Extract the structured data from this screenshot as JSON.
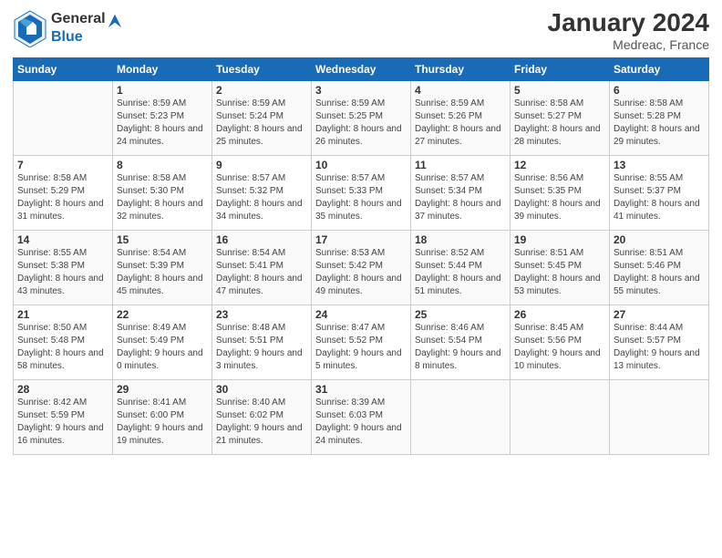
{
  "logo": {
    "text_general": "General",
    "text_blue": "Blue"
  },
  "title": "January 2024",
  "location": "Medreac, France",
  "days_of_week": [
    "Sunday",
    "Monday",
    "Tuesday",
    "Wednesday",
    "Thursday",
    "Friday",
    "Saturday"
  ],
  "weeks": [
    [
      {
        "day": "",
        "sunrise": "",
        "sunset": "",
        "daylight": ""
      },
      {
        "day": "1",
        "sunrise": "Sunrise: 8:59 AM",
        "sunset": "Sunset: 5:23 PM",
        "daylight": "Daylight: 8 hours and 24 minutes."
      },
      {
        "day": "2",
        "sunrise": "Sunrise: 8:59 AM",
        "sunset": "Sunset: 5:24 PM",
        "daylight": "Daylight: 8 hours and 25 minutes."
      },
      {
        "day": "3",
        "sunrise": "Sunrise: 8:59 AM",
        "sunset": "Sunset: 5:25 PM",
        "daylight": "Daylight: 8 hours and 26 minutes."
      },
      {
        "day": "4",
        "sunrise": "Sunrise: 8:59 AM",
        "sunset": "Sunset: 5:26 PM",
        "daylight": "Daylight: 8 hours and 27 minutes."
      },
      {
        "day": "5",
        "sunrise": "Sunrise: 8:58 AM",
        "sunset": "Sunset: 5:27 PM",
        "daylight": "Daylight: 8 hours and 28 minutes."
      },
      {
        "day": "6",
        "sunrise": "Sunrise: 8:58 AM",
        "sunset": "Sunset: 5:28 PM",
        "daylight": "Daylight: 8 hours and 29 minutes."
      }
    ],
    [
      {
        "day": "7",
        "sunrise": "Sunrise: 8:58 AM",
        "sunset": "Sunset: 5:29 PM",
        "daylight": "Daylight: 8 hours and 31 minutes."
      },
      {
        "day": "8",
        "sunrise": "Sunrise: 8:58 AM",
        "sunset": "Sunset: 5:30 PM",
        "daylight": "Daylight: 8 hours and 32 minutes."
      },
      {
        "day": "9",
        "sunrise": "Sunrise: 8:57 AM",
        "sunset": "Sunset: 5:32 PM",
        "daylight": "Daylight: 8 hours and 34 minutes."
      },
      {
        "day": "10",
        "sunrise": "Sunrise: 8:57 AM",
        "sunset": "Sunset: 5:33 PM",
        "daylight": "Daylight: 8 hours and 35 minutes."
      },
      {
        "day": "11",
        "sunrise": "Sunrise: 8:57 AM",
        "sunset": "Sunset: 5:34 PM",
        "daylight": "Daylight: 8 hours and 37 minutes."
      },
      {
        "day": "12",
        "sunrise": "Sunrise: 8:56 AM",
        "sunset": "Sunset: 5:35 PM",
        "daylight": "Daylight: 8 hours and 39 minutes."
      },
      {
        "day": "13",
        "sunrise": "Sunrise: 8:55 AM",
        "sunset": "Sunset: 5:37 PM",
        "daylight": "Daylight: 8 hours and 41 minutes."
      }
    ],
    [
      {
        "day": "14",
        "sunrise": "Sunrise: 8:55 AM",
        "sunset": "Sunset: 5:38 PM",
        "daylight": "Daylight: 8 hours and 43 minutes."
      },
      {
        "day": "15",
        "sunrise": "Sunrise: 8:54 AM",
        "sunset": "Sunset: 5:39 PM",
        "daylight": "Daylight: 8 hours and 45 minutes."
      },
      {
        "day": "16",
        "sunrise": "Sunrise: 8:54 AM",
        "sunset": "Sunset: 5:41 PM",
        "daylight": "Daylight: 8 hours and 47 minutes."
      },
      {
        "day": "17",
        "sunrise": "Sunrise: 8:53 AM",
        "sunset": "Sunset: 5:42 PM",
        "daylight": "Daylight: 8 hours and 49 minutes."
      },
      {
        "day": "18",
        "sunrise": "Sunrise: 8:52 AM",
        "sunset": "Sunset: 5:44 PM",
        "daylight": "Daylight: 8 hours and 51 minutes."
      },
      {
        "day": "19",
        "sunrise": "Sunrise: 8:51 AM",
        "sunset": "Sunset: 5:45 PM",
        "daylight": "Daylight: 8 hours and 53 minutes."
      },
      {
        "day": "20",
        "sunrise": "Sunrise: 8:51 AM",
        "sunset": "Sunset: 5:46 PM",
        "daylight": "Daylight: 8 hours and 55 minutes."
      }
    ],
    [
      {
        "day": "21",
        "sunrise": "Sunrise: 8:50 AM",
        "sunset": "Sunset: 5:48 PM",
        "daylight": "Daylight: 8 hours and 58 minutes."
      },
      {
        "day": "22",
        "sunrise": "Sunrise: 8:49 AM",
        "sunset": "Sunset: 5:49 PM",
        "daylight": "Daylight: 9 hours and 0 minutes."
      },
      {
        "day": "23",
        "sunrise": "Sunrise: 8:48 AM",
        "sunset": "Sunset: 5:51 PM",
        "daylight": "Daylight: 9 hours and 3 minutes."
      },
      {
        "day": "24",
        "sunrise": "Sunrise: 8:47 AM",
        "sunset": "Sunset: 5:52 PM",
        "daylight": "Daylight: 9 hours and 5 minutes."
      },
      {
        "day": "25",
        "sunrise": "Sunrise: 8:46 AM",
        "sunset": "Sunset: 5:54 PM",
        "daylight": "Daylight: 9 hours and 8 minutes."
      },
      {
        "day": "26",
        "sunrise": "Sunrise: 8:45 AM",
        "sunset": "Sunset: 5:56 PM",
        "daylight": "Daylight: 9 hours and 10 minutes."
      },
      {
        "day": "27",
        "sunrise": "Sunrise: 8:44 AM",
        "sunset": "Sunset: 5:57 PM",
        "daylight": "Daylight: 9 hours and 13 minutes."
      }
    ],
    [
      {
        "day": "28",
        "sunrise": "Sunrise: 8:42 AM",
        "sunset": "Sunset: 5:59 PM",
        "daylight": "Daylight: 9 hours and 16 minutes."
      },
      {
        "day": "29",
        "sunrise": "Sunrise: 8:41 AM",
        "sunset": "Sunset: 6:00 PM",
        "daylight": "Daylight: 9 hours and 19 minutes."
      },
      {
        "day": "30",
        "sunrise": "Sunrise: 8:40 AM",
        "sunset": "Sunset: 6:02 PM",
        "daylight": "Daylight: 9 hours and 21 minutes."
      },
      {
        "day": "31",
        "sunrise": "Sunrise: 8:39 AM",
        "sunset": "Sunset: 6:03 PM",
        "daylight": "Daylight: 9 hours and 24 minutes."
      },
      {
        "day": "",
        "sunrise": "",
        "sunset": "",
        "daylight": ""
      },
      {
        "day": "",
        "sunrise": "",
        "sunset": "",
        "daylight": ""
      },
      {
        "day": "",
        "sunrise": "",
        "sunset": "",
        "daylight": ""
      }
    ]
  ]
}
